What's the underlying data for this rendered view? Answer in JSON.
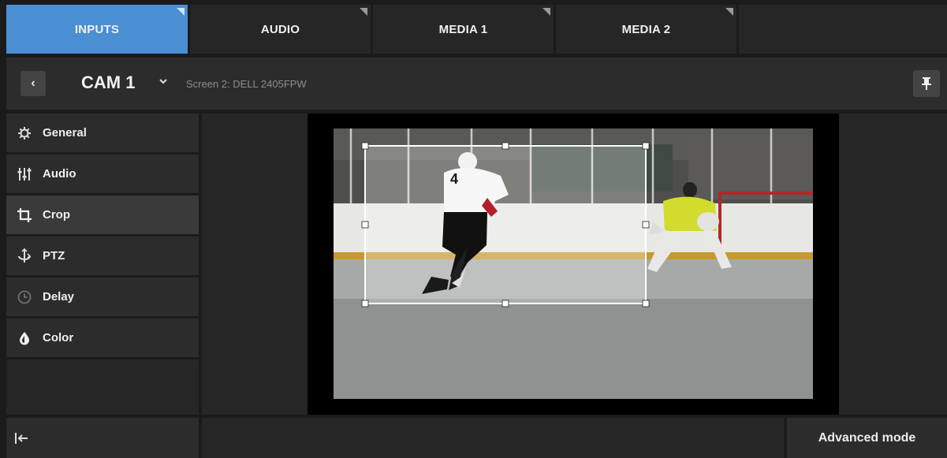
{
  "tabs": [
    {
      "label": "INPUTS",
      "active": true
    },
    {
      "label": "AUDIO",
      "active": false
    },
    {
      "label": "MEDIA 1",
      "active": false
    },
    {
      "label": "MEDIA 2",
      "active": false
    }
  ],
  "header": {
    "back_icon": "chevron-left-icon",
    "title": "CAM 1",
    "title_chevron": "chevron-down-icon",
    "screen_label": "Screen 2: DELL 2405FPW",
    "pin_icon": "pin-icon"
  },
  "sidebar": {
    "items": [
      {
        "label": "General",
        "icon": "gear-icon",
        "active": false
      },
      {
        "label": "Audio",
        "icon": "sliders-icon",
        "active": false
      },
      {
        "label": "Crop",
        "icon": "crop-icon",
        "active": true
      },
      {
        "label": "PTZ",
        "icon": "ptz-icon",
        "active": false
      },
      {
        "label": "Delay",
        "icon": "clock-icon",
        "active": false
      },
      {
        "label": "Color",
        "icon": "drop-icon",
        "active": false
      }
    ]
  },
  "footer": {
    "collapse_icon": "collapse-left-icon",
    "advanced_label": "Advanced mode"
  },
  "colors": {
    "accent": "#4a8fd4",
    "panel": "#2c2c2c",
    "background": "#1b1b1b"
  }
}
